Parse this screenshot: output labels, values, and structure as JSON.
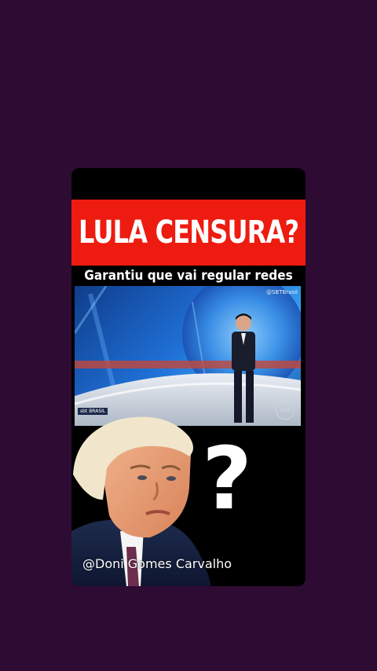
{
  "post": {
    "headline": "LULA CENSURA?",
    "subtitle": "Garantiu que vai regular redes",
    "question_mark": "?",
    "watermark": "@Doni Gomes Carvalho"
  },
  "video": {
    "channel_logo": "sbt BRASIL",
    "channel_handle": "@SBTBrasil",
    "watermark_logo": "sbt"
  },
  "colors": {
    "background": "#2e0b33",
    "card": "#000000",
    "headline_bar": "#ee1b10",
    "text": "#ffffff"
  }
}
